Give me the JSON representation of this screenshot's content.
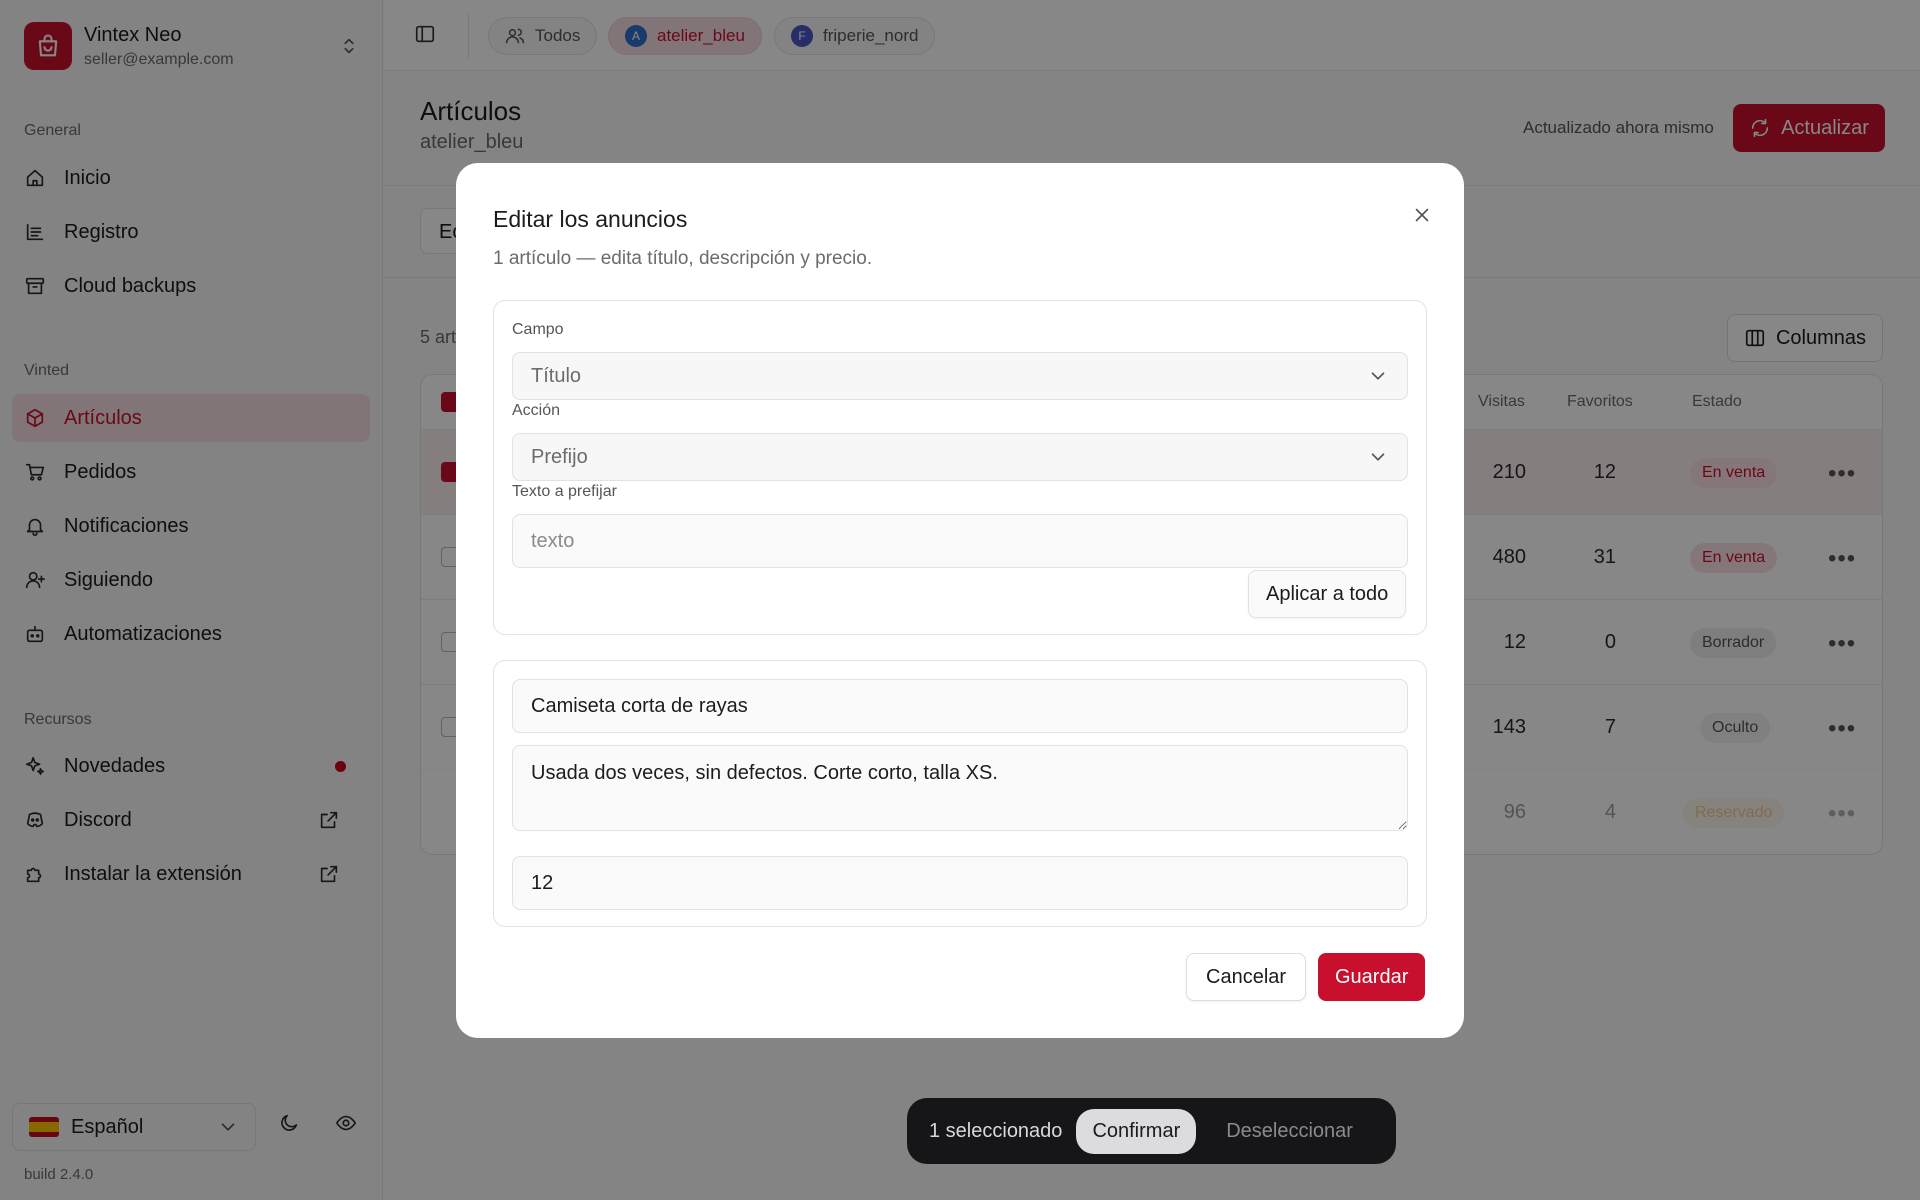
{
  "account": {
    "name": "Vintex Neo",
    "email": "seller@example.com"
  },
  "sidebar": {
    "sections": {
      "general": "General",
      "vinted": "Vinted",
      "resources": "Recursos"
    },
    "general": [
      {
        "label": "Inicio"
      },
      {
        "label": "Registro"
      },
      {
        "label": "Cloud backups"
      }
    ],
    "vinted": [
      {
        "label": "Artículos"
      },
      {
        "label": "Pedidos"
      },
      {
        "label": "Notificaciones"
      },
      {
        "label": "Siguiendo"
      },
      {
        "label": "Automatizaciones"
      }
    ],
    "resources": [
      {
        "label": "Novedades"
      },
      {
        "label": "Discord"
      },
      {
        "label": "Instalar la extensión"
      }
    ],
    "language": "Español",
    "build": "build 2.4.0"
  },
  "topbar": {
    "chips": [
      {
        "label": "Todos"
      },
      {
        "label": "atelier_bleu",
        "initial": "A"
      },
      {
        "label": "friperie_nord",
        "initial": "F"
      }
    ]
  },
  "page": {
    "title": "Artículos",
    "subtitle": "atelier_bleu",
    "updated": "Actualizado ahora mismo",
    "refresh_label": "Actualizar",
    "edit_stub": "Ec",
    "count_stub": "5 art",
    "columns_label": "Columnas"
  },
  "table": {
    "headers": {
      "views": "Visitas",
      "favorites": "Favoritos",
      "status": "Estado"
    },
    "rows": [
      {
        "views": "210",
        "favorites": "12",
        "status": "En venta"
      },
      {
        "views": "480",
        "favorites": "31",
        "status": "En venta"
      },
      {
        "views": "12",
        "favorites": "0",
        "status": "Borrador"
      },
      {
        "views": "143",
        "favorites": "7",
        "status": "Oculto"
      },
      {
        "views": "96",
        "favorites": "4",
        "status": "Reservado"
      }
    ]
  },
  "bulk": {
    "selected": "1 seleccionado",
    "confirm": "Confirmar",
    "deselect": "Deseleccionar"
  },
  "modal": {
    "title": "Editar los anuncios",
    "subtitle": "1 artículo — edita título, descripción y precio.",
    "field_label": "Campo",
    "field_value": "Título",
    "action_label": "Acción",
    "action_value": "Prefijo",
    "text_label": "Texto a prefijar",
    "text_placeholder": "texto",
    "apply_label": "Aplicar a todo",
    "item_title": "Camiseta corta de rayas",
    "item_description": "Usada dos veces, sin defectos. Corte corto, talla XS.",
    "item_price": "12",
    "cancel_label": "Cancelar",
    "save_label": "Guardar"
  },
  "colors": {
    "accent": "#c8102e",
    "avatar_a": "#2f6fcf",
    "avatar_f": "#4a56c6"
  }
}
